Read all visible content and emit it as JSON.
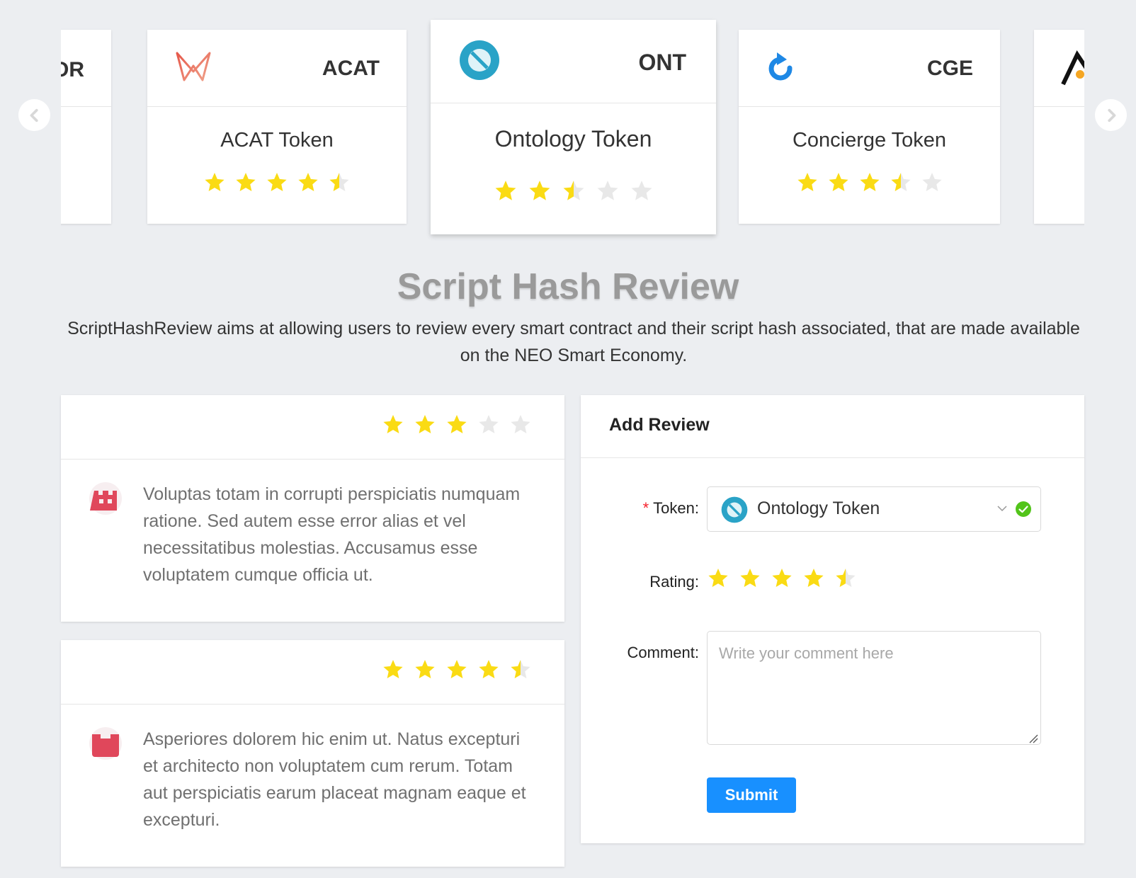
{
  "carousel": {
    "cards": [
      {
        "symbol": "OR",
        "name": "",
        "rating": null
      },
      {
        "symbol": "ACAT",
        "name": "ACAT Token",
        "rating": 4.5,
        "logo": "acat-logo"
      },
      {
        "symbol": "ONT",
        "name": "Ontology Token",
        "rating": 2.5,
        "logo": "ontology-logo"
      },
      {
        "symbol": "CGE",
        "name": "Concierge Token",
        "rating": 3.5,
        "logo": "concierge-logo"
      },
      {
        "symbol": "",
        "name": "",
        "rating": null,
        "logo": "partial-logo"
      }
    ],
    "prev_icon": "chevron-left-icon",
    "next_icon": "chevron-right-icon"
  },
  "header": {
    "title": "Script Hash Review",
    "description": "ScriptHashReview aims at allowing users to review every smart contract and their script hash associated, that are made available on the NEO Smart Economy."
  },
  "reviews": [
    {
      "rating": 3,
      "text": "Voluptas totam in corrupti perspiciatis numquam ratione. Sed autem esse error alias et vel necessitatibus molestias. Accusamus esse voluptatem cumque officia ut.",
      "avatar_color": "#e0475b"
    },
    {
      "rating": 4.5,
      "text": "Asperiores dolorem hic enim ut. Natus excepturi et architecto non voluptatem cum rerum. Totam aut perspiciatis earum placeat magnam eaque et excepturi.",
      "avatar_color": "#e0475b"
    }
  ],
  "form": {
    "title": "Add Review",
    "token_label": "Token",
    "token_required_mark": "*",
    "token_value": "Ontology Token",
    "rating_label": "Rating",
    "rating_value": 4.5,
    "comment_label": "Comment",
    "comment_placeholder": "Write your comment here",
    "submit_label": "Submit",
    "label_colon": ":"
  },
  "colors": {
    "star_on": "#fadb14",
    "star_off": "#e8e8e8",
    "primary": "#1890ff",
    "success": "#52c41a",
    "required": "#f5222d"
  }
}
